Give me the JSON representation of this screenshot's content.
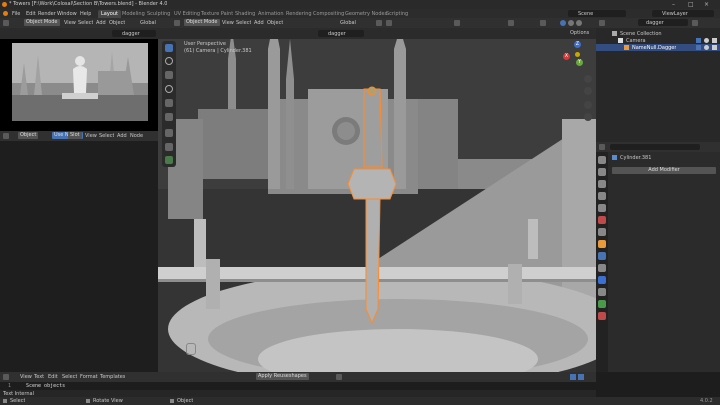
{
  "window": {
    "title": "* Towers [F:\\Work\\Colosal\\Section B\\Towers.blend] - Blender 4.0"
  },
  "menubar": {
    "items": [
      "File",
      "Edit",
      "Render",
      "Window",
      "Help"
    ],
    "workspaces": [
      "Layout",
      "Modeling",
      "Sculpting",
      "UV Editing",
      "Texture Paint",
      "Shading",
      "Animation",
      "Rendering",
      "Compositing",
      "Geometry Nodes",
      "Scripting"
    ],
    "scene_label": "Scene",
    "viewlayer_label": "ViewLayer"
  },
  "left_top_editor": {
    "mode": "Object Mode",
    "menus": [
      "View",
      "Select",
      "Add",
      "Object"
    ],
    "transform": "Global",
    "search": "dagger"
  },
  "node_editor": {
    "type": "Object",
    "tabs": [
      "Use Nodes",
      "Slot"
    ],
    "menus": [
      "View",
      "Select",
      "Add",
      "Node"
    ]
  },
  "viewport": {
    "mode": "Object Mode",
    "menus": [
      "View",
      "Select",
      "Add",
      "Object"
    ],
    "transform": "Global",
    "search": "dagger",
    "overlay_line1": "User Perspective",
    "overlay_line2": "(61) Camera | Cylinder.381",
    "options_label": "Options",
    "gizmo": {
      "x": "X",
      "y": "Y",
      "z": "Z"
    }
  },
  "outliner": {
    "search": "dagger",
    "items": [
      {
        "label": "Scene Collection"
      },
      {
        "label": "Camera"
      },
      {
        "label": "NameNull.Dagger"
      }
    ]
  },
  "properties": {
    "object_name": "Cylinder.381",
    "add_modifier": "Add Modifier"
  },
  "text_editor": {
    "menus": [
      "View",
      "Text",
      "Edit",
      "Select",
      "Format",
      "Templates"
    ],
    "apply_label": "Apply Reuseshapes",
    "line_no": "1",
    "code": "Scene objects"
  },
  "timeline": {
    "label": "Text Internal"
  },
  "statusbar": {
    "left": "Select",
    "middle": "Rotate View",
    "right": "Object",
    "version": "4.0.2"
  },
  "colors": {
    "accent": "#4772b3",
    "selected_orange": "#ff8a2a",
    "active_row": "#334d80",
    "bg": "#1d1d1d"
  }
}
